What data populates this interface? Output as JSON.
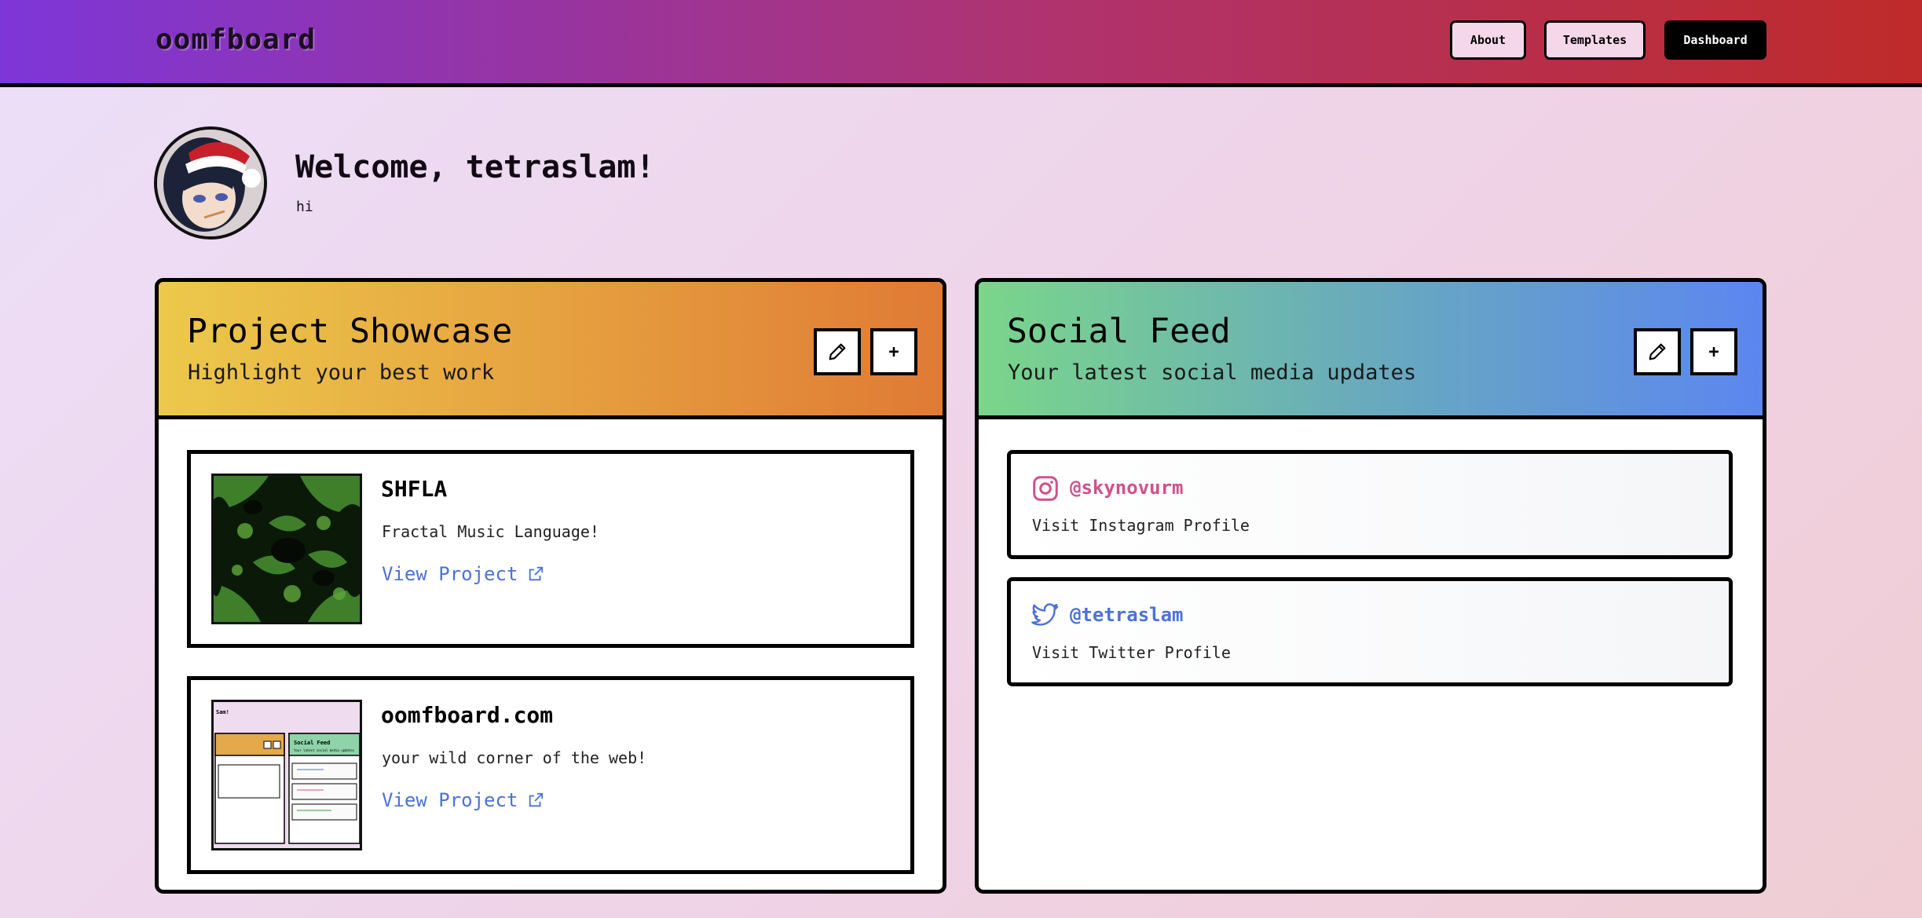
{
  "app": {
    "logo": "oomfboard"
  },
  "nav": {
    "about": "About",
    "templates": "Templates",
    "dashboard": "Dashboard"
  },
  "profile": {
    "welcome": "Welcome, tetraslam!",
    "bio": "hi",
    "avatar_icon": "avatar-image"
  },
  "projects_panel": {
    "title": "Project Showcase",
    "subtitle": "Highlight your best work",
    "edit_icon": "pencil-icon",
    "add_label": "+",
    "gradient": [
      "#ecc94b",
      "#e07a35"
    ],
    "projects": [
      {
        "name": "SHFLA",
        "description": "Fractal Music Language!",
        "link": "View Project"
      },
      {
        "name": "oomfboard.com",
        "description": "your wild corner of the web!",
        "link": "View Project"
      }
    ]
  },
  "social_panel": {
    "title": "Social Feed",
    "subtitle": "Your latest social media updates",
    "edit_icon": "pencil-icon",
    "add_label": "+",
    "gradient": [
      "#7ad68a",
      "#5c86f0"
    ],
    "accounts": [
      {
        "icon": "instagram-icon",
        "handle": "@skynovurm",
        "link": "Visit Instagram Profile",
        "color": "#d0508a"
      },
      {
        "icon": "twitter-icon",
        "handle": "@tetraslam",
        "link": "Visit Twitter Profile",
        "color": "#4b72d8"
      }
    ]
  },
  "thumb_mini": {
    "welcome": "Sam!",
    "social_title": "Social Feed",
    "social_sub": "Your latest social media updates"
  }
}
